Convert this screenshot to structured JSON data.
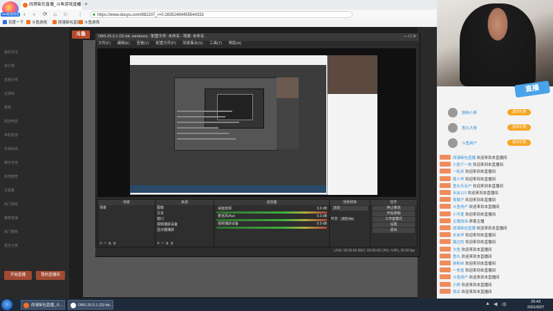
{
  "browser": {
    "logo_label": "360极速浏览器",
    "tab_title": "阎港柴包直播_斗鱼游戏直播",
    "tab_close": "×",
    "new_tab": "+",
    "url": "https://www.douyu.com/962207_r=0.28352494455544332",
    "bookmarks": [
      "百度一下",
      "斗鱼游戏",
      "阎港柴包直播",
      "斗鱼游戏"
    ],
    "bookmark_colors": [
      "#2a6ee8",
      "#f36f21",
      "#f36f21",
      "#f36f21"
    ],
    "nav_icons": {
      "back": "‹",
      "forward": "›",
      "reload": "⟳",
      "home": "⌂",
      "star": "☆",
      "settings": "⋮"
    }
  },
  "douyu": {
    "logo": "斗鱼",
    "nav_items": [
      "我的关注",
      "排行榜",
      "直播分类",
      "云游戏",
      "赛事",
      "网游竞技",
      "单机热游",
      "手游休闲",
      "娱乐天地",
      "科技教育",
      "正能量",
      "热门游戏",
      "推荐直播",
      "热门推荐",
      "更多分类"
    ],
    "buttons": [
      "开始直播",
      "我的直播间"
    ]
  },
  "obs": {
    "title": "OBS 25.0.1 (32-bit, windows) - 配置文件: 未命名 - 场景: 未命名",
    "menu": [
      "文件(F)",
      "编辑(E)",
      "查看(V)",
      "配置文件(P)",
      "场景集合(S)",
      "工具(T)",
      "帮助(H)"
    ],
    "docks": {
      "scenes": {
        "title": "场景",
        "items": [
          "场景"
        ]
      },
      "sources": {
        "title": "来源",
        "items": [
          "图像",
          "文本",
          "窗口",
          "视频捕获设备",
          "显示器捕获"
        ]
      },
      "mixer": {
        "title": "混音器",
        "tracks": [
          {
            "name": "桌面音频",
            "db": "0.0 dB"
          },
          {
            "name": "麦克风/Aux",
            "db": "0.0 dB"
          },
          {
            "name": "视频捕获设备",
            "db": "0.0 dB"
          }
        ]
      },
      "transitions": {
        "title": "场景转换",
        "type": "淡出",
        "duration_label": "时长",
        "duration": "300 ms"
      },
      "controls": {
        "title": "控件",
        "buttons": [
          "停止推流",
          "开始录制",
          "工作室模式",
          "设置",
          "退出"
        ]
      }
    },
    "dock_buttons": [
      "+",
      "−",
      "∧",
      "∨"
    ],
    "status": "LIVE: 00:00:00    REC: 00:00:00    CPU: 4.8%, 30.00 fps"
  },
  "chat": {
    "watermark": "直播",
    "gift_users": [
      {
        "name": "铁粉小胖",
        "badge": "送出礼物"
      },
      {
        "name": "鱼丸大佬",
        "badge": "送出礼物"
      },
      {
        "name": "斗鱼用户",
        "badge": "送出礼物"
      }
    ],
    "messages": [
      {
        "user": "阎港柴包直播",
        "text": "欢迎来到本直播间"
      },
      {
        "user": "小鱼干一枚",
        "text": "欢迎来到本直播间"
      },
      {
        "user": "一粒米",
        "text": "欢迎来到本直播间"
      },
      {
        "user": "路人甲",
        "text": "欢迎来到本直播间"
      },
      {
        "user": "鱼丸专业户",
        "text": "欢迎来到本直播间"
      },
      {
        "user": "水友123",
        "text": "欢迎来到本直播间"
      },
      {
        "user": "夜猫子",
        "text": "欢迎来到本直播间"
      },
      {
        "user": "斗鱼用户",
        "text": "欢迎来到本直播间"
      },
      {
        "user": "小可爱",
        "text": "欢迎来到本直播间"
      },
      {
        "user": "主播加油",
        "text": "恭喜主播"
      },
      {
        "user": "阎港柴包直播",
        "text": "欢迎来到本直播间"
      },
      {
        "user": "水友甲",
        "text": "欢迎来到本直播间"
      },
      {
        "user": "路过的",
        "text": "欢迎来到本直播间"
      },
      {
        "user": "大鱼",
        "text": "欢迎来到本直播间"
      },
      {
        "user": "鱼丸",
        "text": "欢迎来到本直播间"
      },
      {
        "user": "新粉丝",
        "text": "欢迎来到本直播间"
      },
      {
        "user": "一条鱼",
        "text": "欢迎来到本直播间"
      },
      {
        "user": "斗鱼用户",
        "text": "欢迎来到本直播间"
      },
      {
        "user": "小胖",
        "text": "欢迎来到本直播间"
      },
      {
        "user": "观众",
        "text": "欢迎来到本直播间"
      }
    ]
  },
  "taskbar": {
    "tasks": [
      {
        "label": "阎港柴包直播_斗...",
        "color": "#f36f21"
      },
      {
        "label": "OBS 25.0.1 (32-bit...",
        "color": "#ffffff"
      }
    ],
    "time": "20:43",
    "date": "2021/9/27"
  }
}
